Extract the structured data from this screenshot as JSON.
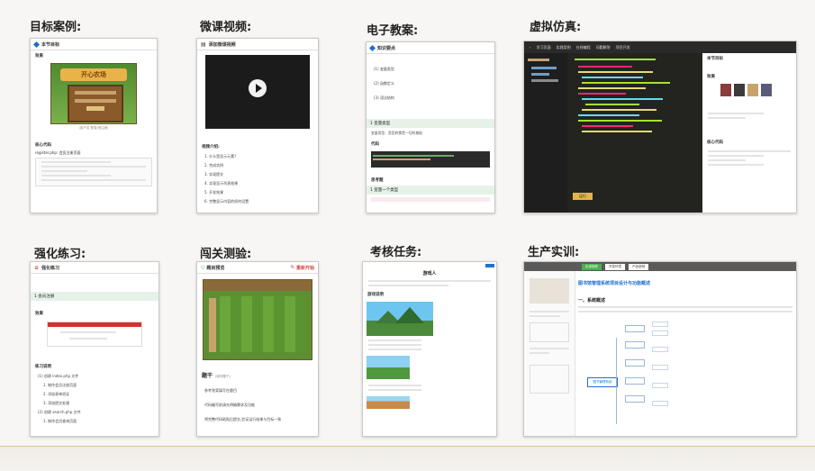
{
  "titles": {
    "target_case": "目标案例:",
    "micro_video": "微课视频:",
    "e_lesson": "电子教案:",
    "virtual_sim": "虚拟仿真:",
    "practice": "强化练习:",
    "checkpoint": "闯关测验:",
    "assessment": "考核任务:",
    "training": "生产实训:"
  },
  "target_case_panel": {
    "header": "本节目标",
    "section1": "效果",
    "game_title": "开心农场",
    "caption": "(用户名  登录/请注册)",
    "section2": "核心代码",
    "code_label": "register.php: 会员注册页面"
  },
  "micro_video_panel": {
    "header": "添加微课视频",
    "play_caption": "",
    "section": "视频介绍:",
    "items": [
      "1. 什么是显示元素?",
      "2. 完成实例",
      "3. 实现提交",
      "4. 实现显示列表效果",
      "5. 开发效果",
      "6. 完整显示内容的如何设置"
    ]
  },
  "e_lesson_panel": {
    "header": "知识要点",
    "items": [
      "(1) 变量类型",
      "(2) 函数定义",
      "(3) 语法结构"
    ],
    "bar1": "1   变量类型",
    "text1": "变量类型、类型转换是一切的基础",
    "section": "代码",
    "section2": "思考题",
    "bar2": "1   变量一个类型"
  },
  "virtual_sim_panel": {
    "tabs": [
      "学习页面",
      "实践案例",
      "在线编程",
      "问题解答",
      "项目开发"
    ],
    "btn": "运行",
    "right_title": "本节目标",
    "right_section": "效果",
    "right_code": "核心代码"
  },
  "practice_panel": {
    "header": "强化练习",
    "bar": "1   会员注册",
    "section1": "效果",
    "section2": "练习说明",
    "items": [
      "(1) 创建 index.php 文件",
      "1. 制作会员注册页面",
      "2. 添加表单验证",
      "3. 添加提交处理",
      "(2) 创建 search.php 文件",
      "1. 制作会员查询页面"
    ]
  },
  "checkpoint_panel": {
    "header": "题目预览",
    "right_label": "重新开始",
    "q_title": "题干",
    "q_sub": "(填写题干)",
    "lines": [
      "参考答案填写在题目",
      "代码编写前请先明确需求及功能",
      "将完整代码粘贴后提交,验证运行结果与目标一致"
    ]
  },
  "assessment_panel": {
    "title": "游戏人",
    "section": "游戏说明"
  },
  "training_panel": {
    "tabs": [
      "实训指导",
      "开发环境",
      "产品说明"
    ],
    "title": "图书馆管理系统项目设计与功能概述",
    "section": "一、系统概述",
    "node": "图书管理系统"
  }
}
